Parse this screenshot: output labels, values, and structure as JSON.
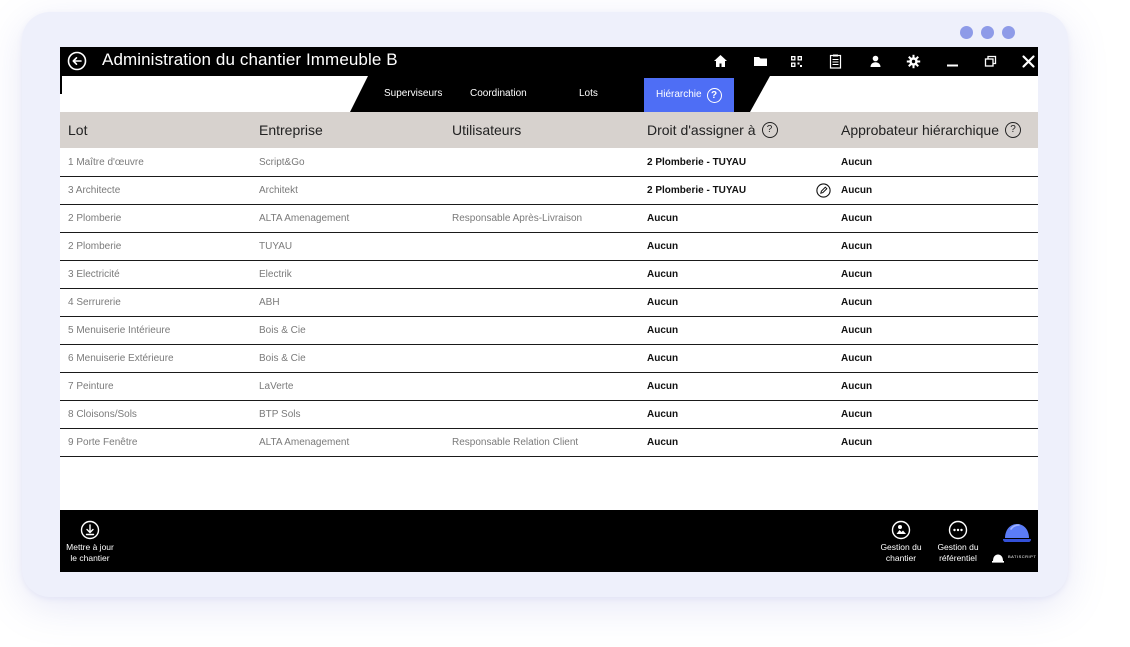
{
  "window": {
    "title": "Administration du chantier Immeuble B"
  },
  "tabs": [
    {
      "label": "Superviseurs",
      "active": false
    },
    {
      "label": "Coordination",
      "active": false
    },
    {
      "label": "Lots",
      "active": false
    },
    {
      "label": "Hiérarchie",
      "active": true
    }
  ],
  "table": {
    "headers": {
      "lot": "Lot",
      "entreprise": "Entreprise",
      "utilisateurs": "Utilisateurs",
      "droit": "Droit d'assigner à",
      "approbateur": "Approbateur hiérarchique"
    },
    "rows": [
      {
        "lot": "1 Maître d'œuvre",
        "entreprise": "Script&Go",
        "utilisateurs": "",
        "droit": "2 Plomberie - TUYAU",
        "approbateur": "Aucun"
      },
      {
        "lot": "3 Architecte",
        "entreprise": "Architekt",
        "utilisateurs": "",
        "droit": "2 Plomberie - TUYAU",
        "approbateur": "Aucun"
      },
      {
        "lot": "2 Plomberie",
        "entreprise": "ALTA Amenagement",
        "utilisateurs": "Responsable Après-Livraison",
        "droit": "Aucun",
        "approbateur": "Aucun"
      },
      {
        "lot": "2 Plomberie",
        "entreprise": "TUYAU",
        "utilisateurs": "",
        "droit": "Aucun",
        "approbateur": "Aucun"
      },
      {
        "lot": "3 Electricité",
        "entreprise": "Electrik",
        "utilisateurs": "",
        "droit": "Aucun",
        "approbateur": "Aucun"
      },
      {
        "lot": "4 Serrurerie",
        "entreprise": "ABH",
        "utilisateurs": "",
        "droit": "Aucun",
        "approbateur": "Aucun"
      },
      {
        "lot": "5 Menuiserie Intérieure",
        "entreprise": "Bois & Cie",
        "utilisateurs": "",
        "droit": "Aucun",
        "approbateur": "Aucun"
      },
      {
        "lot": "6 Menuiserie Extérieure",
        "entreprise": "Bois & Cie",
        "utilisateurs": "",
        "droit": "Aucun",
        "approbateur": "Aucun"
      },
      {
        "lot": "7 Peinture",
        "entreprise": "LaVerte",
        "utilisateurs": "",
        "droit": "Aucun",
        "approbateur": "Aucun"
      },
      {
        "lot": "8 Cloisons/Sols",
        "entreprise": "BTP Sols",
        "utilisateurs": "",
        "droit": "Aucun",
        "approbateur": "Aucun"
      },
      {
        "lot": "9 Porte Fenêtre",
        "entreprise": "ALTA Amenagement",
        "utilisateurs": "Responsable  Relation Client",
        "droit": "Aucun",
        "approbateur": "Aucun"
      }
    ]
  },
  "bottom": {
    "update_line1": "Mettre à jour",
    "update_line2": "le chantier",
    "gestion_chantier_line1": "Gestion du",
    "gestion_chantier_line2": "chantier",
    "gestion_ref_line1": "Gestion du",
    "gestion_ref_line2": "référentiel",
    "brand": "BATISCRIPT"
  },
  "icons": {
    "toolbar": [
      "home-icon",
      "folder-icon",
      "qr-code-icon",
      "clipboard-icon",
      "user-icon",
      "gear-icon",
      "minimize-icon",
      "restore-icon",
      "close-icon"
    ]
  },
  "colors": {
    "accent": "#4e6ef5",
    "header_bg": "#d7d2ce",
    "frame_dots": "#8e9be8"
  }
}
